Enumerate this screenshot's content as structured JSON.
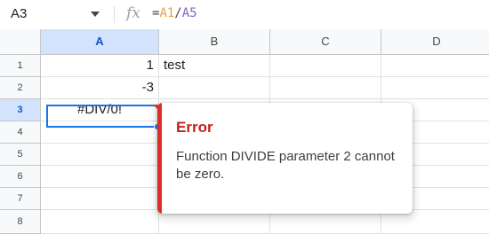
{
  "formula_bar": {
    "cell_ref": "A3",
    "fx_label": "fx",
    "formula": {
      "prefix": "=",
      "ref1": "A1",
      "operator": "/",
      "ref2": "A5"
    }
  },
  "columns": [
    "A",
    "B",
    "C",
    "D"
  ],
  "rows": [
    "1",
    "2",
    "3",
    "4",
    "5",
    "6",
    "7",
    "8"
  ],
  "cells": {
    "A1": "1",
    "B1": "test",
    "A2": "-3",
    "A3": "#DIV/0!"
  },
  "error_popup": {
    "title": "Error",
    "message": "Function DIVIDE parameter 2 cannot be zero."
  },
  "colors": {
    "selection": "#1a73e8",
    "error": "#d93025",
    "ref1": "#e8a33d",
    "ref2": "#8a63c4"
  }
}
